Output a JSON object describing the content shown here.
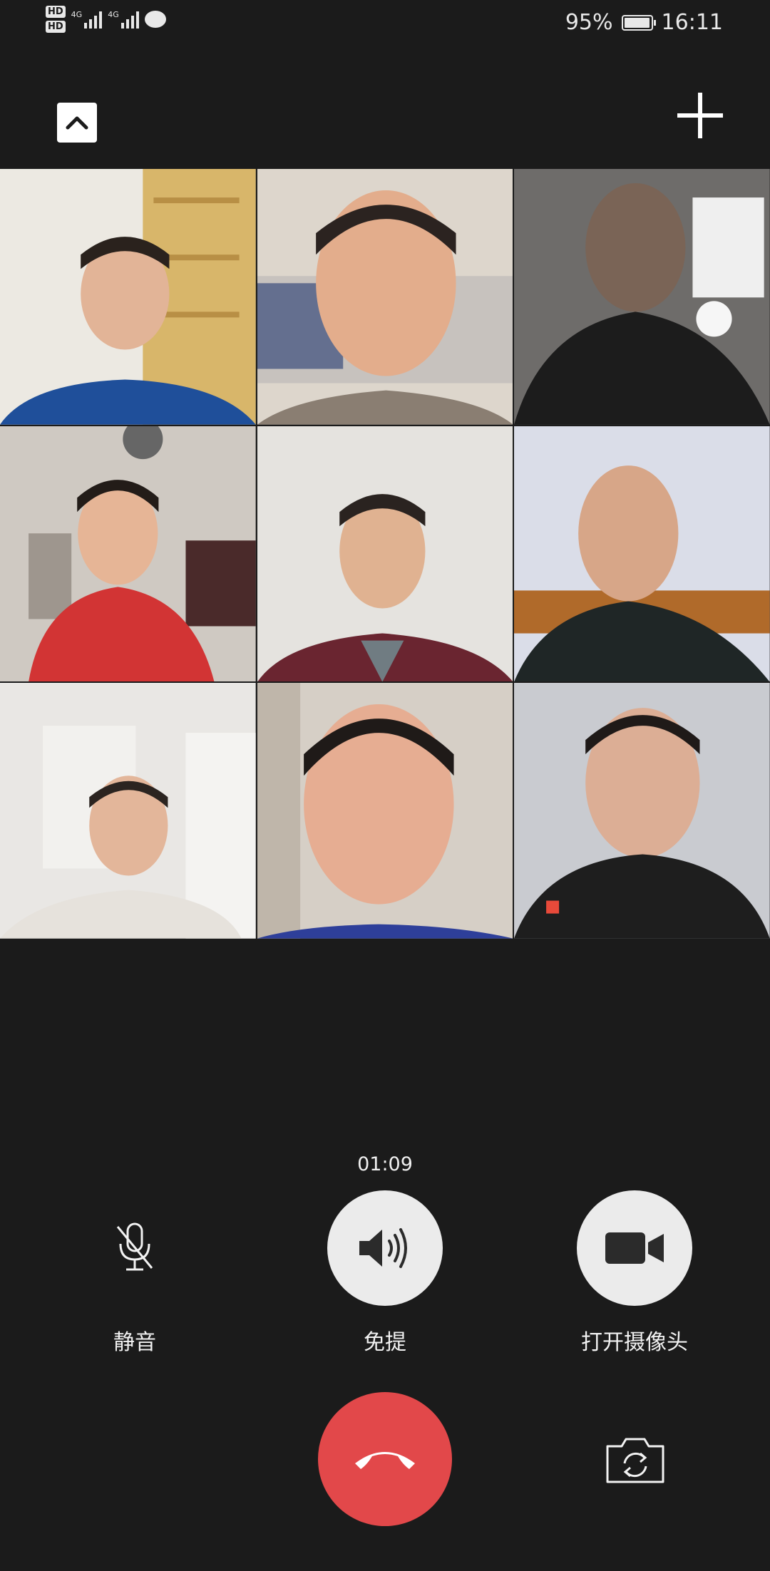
{
  "status_bar": {
    "hd1": "HD",
    "hd2": "HD",
    "signal1_type": "4G",
    "signal2_type": "4G",
    "battery_percent": "95%",
    "time": "16:11",
    "icons": [
      "hd-icon",
      "signal-icon",
      "wechat-message-icon",
      "battery-icon"
    ]
  },
  "header": {
    "collapse_icon": "chevron-up-icon",
    "add_icon": "plus-icon"
  },
  "participants": [
    {
      "position": "row1-col1",
      "shirt_color": "#1f4f9a"
    },
    {
      "position": "row1-col2",
      "shirt_color": "#8a7e72"
    },
    {
      "position": "row1-col3",
      "shirt_color": "#1c1c1c"
    },
    {
      "position": "row2-col1",
      "shirt_color": "#d23434"
    },
    {
      "position": "row2-col2",
      "shirt_color": "#6a2530"
    },
    {
      "position": "row2-col3",
      "shirt_color": "#1f2626"
    },
    {
      "position": "row3-col1",
      "shirt_color": "#e6e2dc"
    },
    {
      "position": "row3-col2",
      "shirt_color": "#2e3f9a"
    },
    {
      "position": "row3-col3",
      "shirt_color": "#1e1e1e"
    }
  ],
  "call": {
    "duration": "01:09"
  },
  "controls": {
    "mute_label": "静音",
    "speaker_label": "免提",
    "camera_label": "打开摄像头",
    "mute_icon": "microphone-muted-icon",
    "speaker_icon": "speaker-icon",
    "camera_icon": "video-camera-icon",
    "hangup_icon": "hang-up-phone-icon",
    "switch_camera_icon": "camera-switch-icon"
  },
  "colors": {
    "background": "#1b1b1b",
    "hangup": "#e2484a",
    "control_circle": "#ebebeb"
  }
}
